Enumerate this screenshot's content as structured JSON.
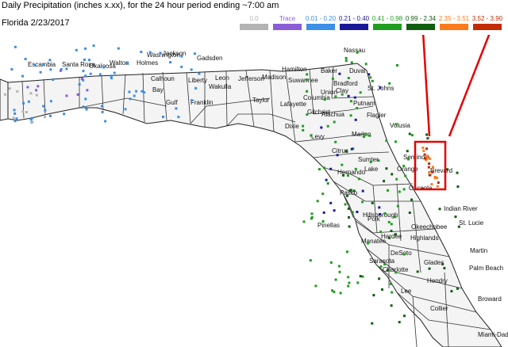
{
  "header": {
    "title": "Daily Precipitation (inches  x.xx),  for the 24 hour period ending ~7:00 am",
    "subtitle": "Florida 2/23/2017"
  },
  "legend": [
    {
      "label": "0.0",
      "color": "#b3b3b3"
    },
    {
      "label": "Trace",
      "color": "#8a5cd6"
    },
    {
      "label": "0.01 - 0.20",
      "color": "#3b8fe6"
    },
    {
      "label": "0.21 - 0.40",
      "color": "#1a1a99"
    },
    {
      "label": "0.41 - 0.98",
      "color": "#1f9e1f"
    },
    {
      "label": "0.99 - 2.34",
      "color": "#0f5e0f"
    },
    {
      "label": "2.35 - 3.51",
      "color": "#ff7a1a"
    },
    {
      "label": "3.52 - 3.90",
      "color": "#c42a00"
    }
  ],
  "counties": [
    "Escambia",
    "Santa Rosa",
    "Okaloosa",
    "Walton",
    "Holmes",
    "Washington",
    "Jackson",
    "Gadsden",
    "Calhoun",
    "Liberty",
    "Bay",
    "Gulf",
    "Franklin",
    "Wakulla",
    "Leon",
    "Jefferson",
    "Madison",
    "Hamilton",
    "Suwannee",
    "Taylor",
    "Lafayette",
    "Dixie",
    "Gilchrist",
    "Columbia",
    "Union",
    "Baker",
    "Nassau",
    "Duval",
    "Clay",
    "St. Johns",
    "Bradford",
    "Alachua",
    "Putnam",
    "Flagler",
    "Levy",
    "Marion",
    "Volusia",
    "Citrus",
    "Sumter",
    "Lake",
    "Seminole",
    "Orange",
    "Brevard",
    "Hernando",
    "Pasco",
    "Polk",
    "Osceola",
    "Pinellas",
    "Hillsborough",
    "Manatee",
    "Hardee",
    "Highlands",
    "Indian River",
    "Okeechobee",
    "St. Lucie",
    "Sarasota",
    "DeSoto",
    "Glades",
    "Martin",
    "Charlotte",
    "Lee",
    "Hendry",
    "Palm Beach",
    "Collier",
    "Broward",
    "Miami-Dade"
  ],
  "colors": {
    "land": "#f4f4f4",
    "water": "#ffffff",
    "border": "#222222",
    "highlight_box": "#e60000"
  }
}
